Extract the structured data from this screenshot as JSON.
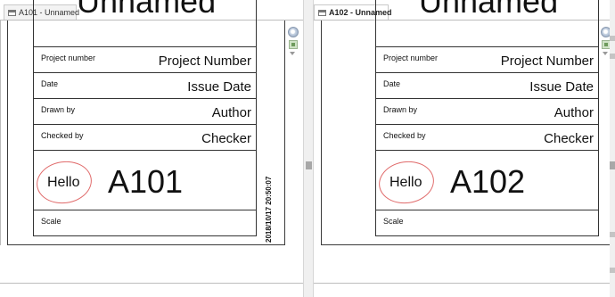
{
  "tabs": [
    {
      "label": "A101 - Unnamed",
      "active": false
    },
    {
      "label": "A102 - Unnamed",
      "active": true
    }
  ],
  "sheets": [
    {
      "title_fragment": "Unnamed",
      "rows": [
        {
          "label": "Project number",
          "value": "Project  Number"
        },
        {
          "label": "Date",
          "value": "Issue Date"
        },
        {
          "label": "Drawn by",
          "value": "Author"
        },
        {
          "label": "Checked by",
          "value": "Checker"
        }
      ],
      "annotation": "Hello",
      "sheet_number": "A101",
      "scale_label": "Scale",
      "timestamp": "2018/10/17 20:50:07"
    },
    {
      "title_fragment": "Unnamed",
      "rows": [
        {
          "label": "Project number",
          "value": "Project  Number"
        },
        {
          "label": "Date",
          "value": "Issue Date"
        },
        {
          "label": "Drawn by",
          "value": "Author"
        },
        {
          "label": "Checked by",
          "value": "Checker"
        }
      ],
      "annotation": "Hello",
      "sheet_number": "A102",
      "scale_label": "Scale"
    }
  ],
  "colors": {
    "annotation_circle": "#e06a6a",
    "border": "#333333"
  },
  "icons": [
    "document-tab-icon",
    "navigation-wheel-icon",
    "zoom-region-icon",
    "dropdown-arrow-icon"
  ]
}
